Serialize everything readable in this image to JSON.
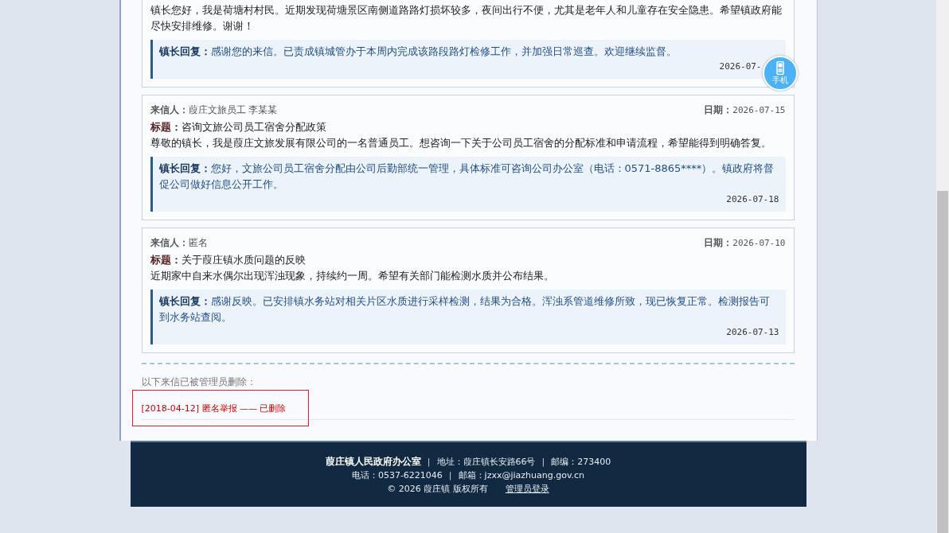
{
  "letters": [
    {
      "body": "镇长您好，我是荷塘村村民。近期发现荷塘景区南侧道路路灯损坏较多，夜间出行不便，尤其是老年人和儿童存在安全隐患。希望镇政府能尽快安排维修。谢谢！",
      "reply": {
        "label": "镇长回复：",
        "text": "感谢您的来信。已责成镇城管办于本周内完成该路段路灯检修工作，并加强日常巡查。欢迎继续监督。",
        "date": "2026-07-"
      }
    },
    {
      "sender_label": "来信人：",
      "sender": "葭庄文旅员工 李某某",
      "date_label": "日期：",
      "date": "2026-07-15",
      "title_label": "标题：",
      "title": "咨询文旅公司员工宿舍分配政策",
      "body": "尊敬的镇长，我是葭庄文旅发展有限公司的一名普通员工。想咨询一下关于公司员工宿舍的分配标准和申请流程，希望能得到明确答复。",
      "reply": {
        "label": "镇长回复：",
        "text": "您好，文旅公司员工宿舍分配由公司后勤部统一管理，具体标准可咨询公司办公室（电话：0571-8865****）。镇政府将督促公司做好信息公开工作。",
        "date": "2026-07-18"
      }
    },
    {
      "sender_label": "来信人：",
      "sender": "匿名",
      "date_label": "日期：",
      "date": "2026-07-10",
      "title_label": "标题：",
      "title": "关于葭庄镇水质问题的反映",
      "body": "近期家中自来水偶尔出现浑浊现象，持续约一周。希望有关部门能检测水质并公布结果。",
      "reply": {
        "label": "镇长回复：",
        "text": "感谢反映。已安排镇水务站对相关片区水质进行采样检测，结果为合格。浑浊系管道维修所致，现已恢复正常。检测报告可到水务站查阅。",
        "date": "2026-07-13"
      }
    }
  ],
  "deleted_section": {
    "heading": "以下来信已被管理员删除：",
    "items": [
      {
        "text": "[2018-04-12] 匿名举报 —— 已删除",
        "highlighted": true
      }
    ]
  },
  "footer": {
    "lines": [
      [
        {
          "kind": "strong",
          "text": "葭庄镇人民政府办公室"
        },
        {
          "kind": "sep",
          "text": "|"
        },
        {
          "kind": "text",
          "text": "地址：葭庄镇长安路66号"
        },
        {
          "kind": "sep",
          "text": "|"
        },
        {
          "kind": "text",
          "text": "邮编：273400"
        }
      ],
      [
        {
          "kind": "text",
          "text": "电话：0537-6221046"
        },
        {
          "kind": "sep",
          "text": "|"
        },
        {
          "kind": "text",
          "text": "邮箱：jzxx@jiazhuang.gov.cn"
        }
      ],
      [
        {
          "kind": "text",
          "text": "© 2026 葭庄镇 版权所有"
        },
        {
          "kind": "link",
          "text": "管理员登录"
        }
      ]
    ]
  },
  "float_button": {
    "label": "手机"
  }
}
